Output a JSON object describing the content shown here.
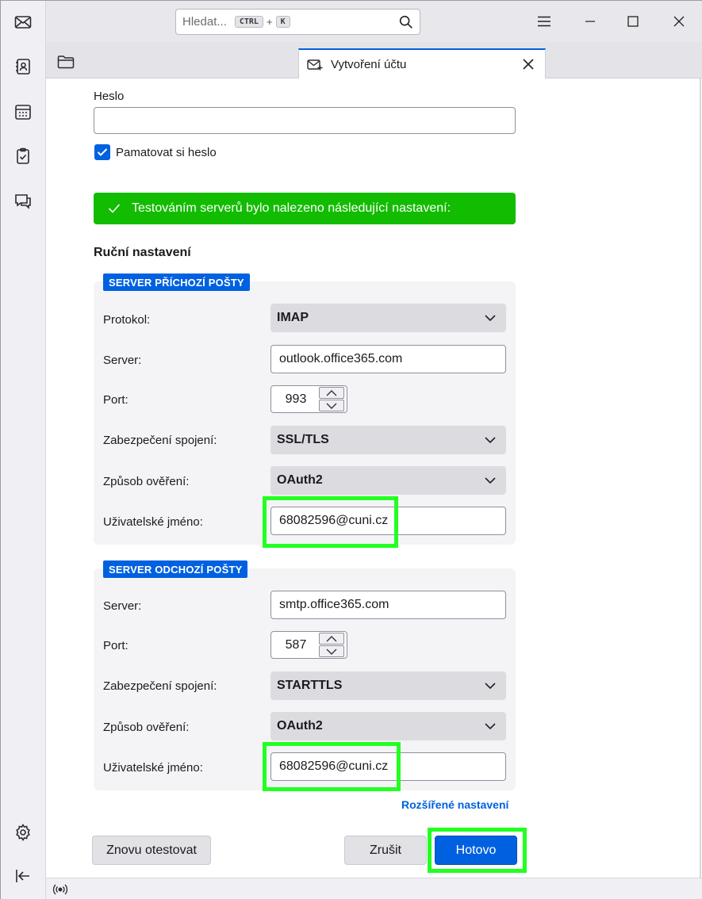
{
  "search": {
    "placeholder": "Hledat...",
    "shortcut_mod": "CTRL",
    "shortcut_plus": "+",
    "shortcut_key": "K"
  },
  "tab": {
    "title": "Vytvoření účtu"
  },
  "form": {
    "password_label": "Heslo",
    "password_value": "",
    "remember_label": "Pamatovat si heslo",
    "remember_checked": true,
    "success_message": "Testováním serverů bylo nalezeno následující nastavení:",
    "manual_heading": "Ruční nastavení"
  },
  "incoming": {
    "legend": "SERVER PŘÍCHOZÍ POŠTY",
    "protocol_label": "Protokol:",
    "protocol_value": "IMAP",
    "server_label": "Server:",
    "server_value": "outlook.office365.com",
    "port_label": "Port:",
    "port_value": "993",
    "security_label": "Zabezpečení spojení:",
    "security_value": "SSL/TLS",
    "auth_label": "Způsob ověření:",
    "auth_value": "OAuth2",
    "username_label": "Uživatelské jméno:",
    "username_value": "68082596@cuni.cz"
  },
  "outgoing": {
    "legend": "SERVER ODCHOZÍ POŠTY",
    "server_label": "Server:",
    "server_value": "smtp.office365.com",
    "port_label": "Port:",
    "port_value": "587",
    "security_label": "Zabezpečení spojení:",
    "security_value": "STARTTLS",
    "auth_label": "Způsob ověření:",
    "auth_value": "OAuth2",
    "username_label": "Uživatelské jméno:",
    "username_value": "68082596@cuni.cz"
  },
  "actions": {
    "advanced_link": "Rozšířené nastavení",
    "retest": "Znovu otestovat",
    "cancel": "Zrušit",
    "done": "Hotovo"
  },
  "colors": {
    "accent": "#0061e0",
    "success": "#12bc00",
    "highlight": "#22ff22"
  }
}
